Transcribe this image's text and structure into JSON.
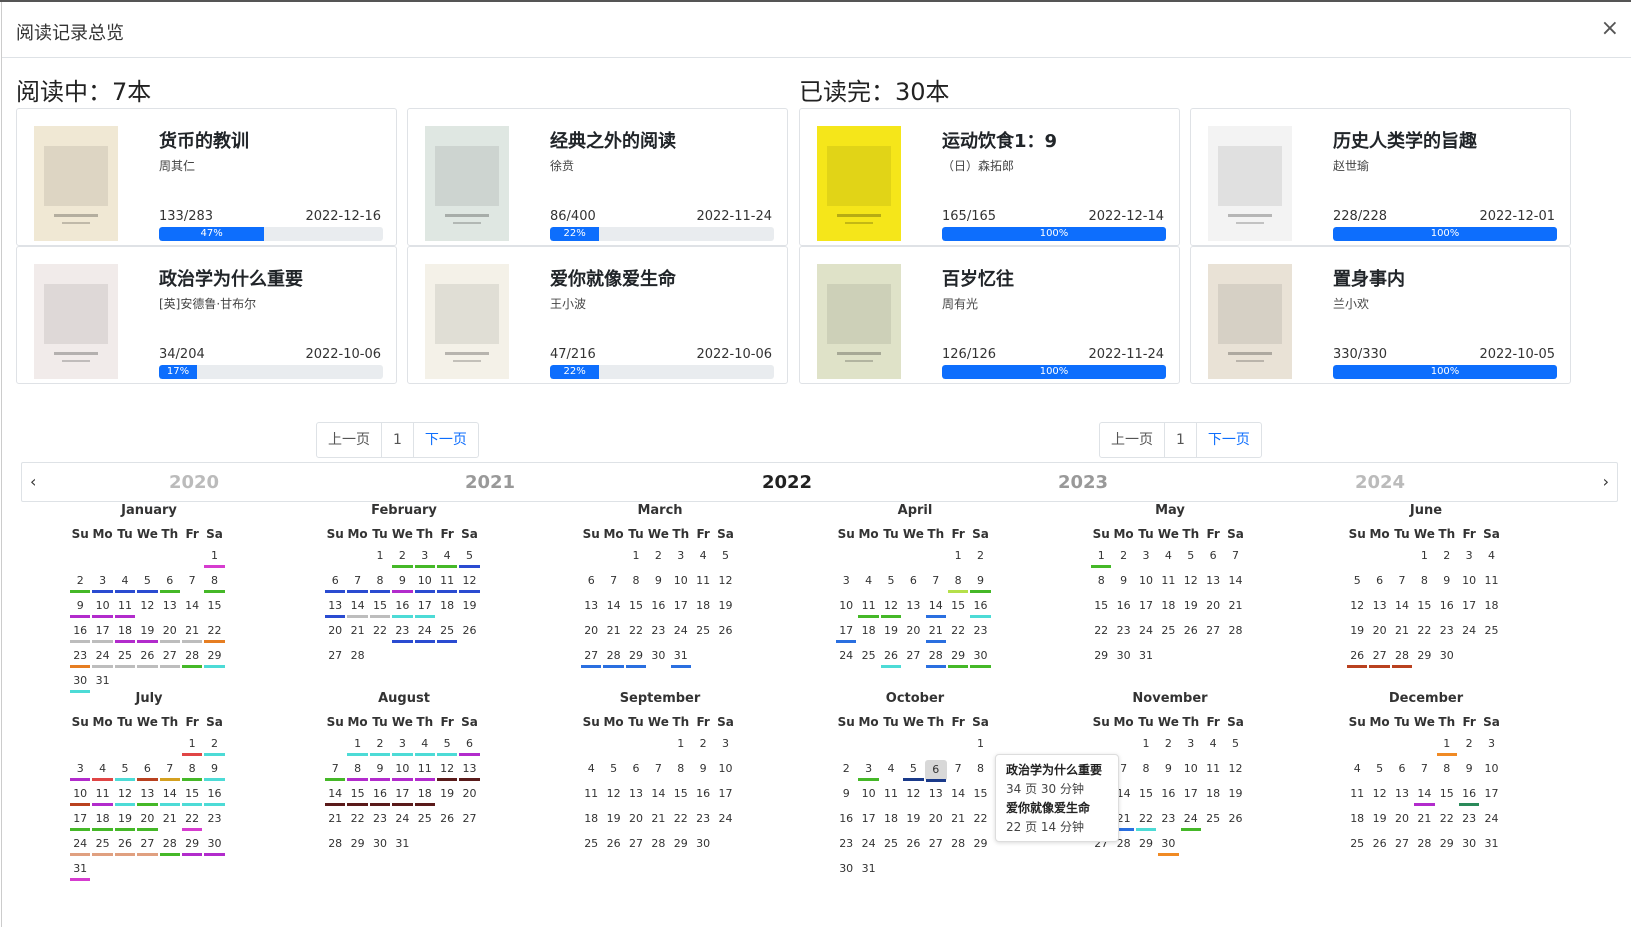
{
  "title": "阅读记录总览",
  "close_label": "×",
  "reading": {
    "heading": "阅读中：7本",
    "books": [
      {
        "title": "货币的教训",
        "author": "周其仁",
        "progress": "133/283",
        "date": "2022-12-16",
        "percent": "47%",
        "ratio": 0.47,
        "cover_color": "#f0e8d4"
      },
      {
        "title": "经典之外的阅读",
        "author": "徐贲",
        "progress": "86/400",
        "date": "2022-11-24",
        "percent": "22%",
        "ratio": 0.22,
        "cover_color": "#dfe7e2"
      },
      {
        "title": "政治学为什么重要",
        "author": "[英]安德鲁·甘布尔",
        "progress": "34/204",
        "date": "2022-10-06",
        "percent": "17%",
        "ratio": 0.17,
        "cover_color": "#f1ebea"
      },
      {
        "title": "爱你就像爱生命",
        "author": "王小波",
        "progress": "47/216",
        "date": "2022-10-06",
        "percent": "22%",
        "ratio": 0.22,
        "cover_color": "#f4f1e8"
      }
    ],
    "pager": {
      "prev": "上一页",
      "page": "1",
      "next": "下一页"
    }
  },
  "finished": {
    "heading": "已读完：30本",
    "books": [
      {
        "title": "运动饮食1：9",
        "author": "（日）森拓郎",
        "progress": "165/165",
        "date": "2022-12-14",
        "percent": "100%",
        "ratio": 1,
        "cover_color": "#f5e61a"
      },
      {
        "title": "历史人类学的旨趣",
        "author": "赵世瑜",
        "progress": "228/228",
        "date": "2022-12-01",
        "percent": "100%",
        "ratio": 1,
        "cover_color": "#f3f3f3"
      },
      {
        "title": "百岁忆往",
        "author": "周有光",
        "progress": "126/126",
        "date": "2022-11-24",
        "percent": "100%",
        "ratio": 1,
        "cover_color": "#dfe2c8"
      },
      {
        "title": "置身事内",
        "author": "兰小欢",
        "progress": "330/330",
        "date": "2022-10-05",
        "percent": "100%",
        "ratio": 1,
        "cover_color": "#e9e2d6"
      }
    ],
    "pager": {
      "prev": "上一页",
      "page": "1",
      "next": "下一页"
    }
  },
  "years": [
    "2020",
    "2021",
    "2022",
    "2023",
    "2024"
  ],
  "current_year": "2022",
  "weekdays": [
    "Su",
    "Mo",
    "Tu",
    "We",
    "Th",
    "Fr",
    "Sa"
  ],
  "months": [
    {
      "name": "January",
      "start": 6,
      "days": 31,
      "marks": {
        "1": [
          "#d63ccf"
        ],
        "2": [
          "#45b828"
        ],
        "3": [
          "#2a4bd1"
        ],
        "4": [
          "#2a4bd1"
        ],
        "5": [
          "#2a4bd1"
        ],
        "6": [
          "#45b828"
        ],
        "8": [
          "#45b828"
        ],
        "9": [
          "#b22bcc"
        ],
        "10": [
          "#b22bcc"
        ],
        "11": [
          "#b22bcc"
        ],
        "16": [
          "#bdbdbd"
        ],
        "17": [
          "#bdbdbd"
        ],
        "18": [
          "#b22bcc"
        ],
        "19": [
          "#b22bcc"
        ],
        "20": [
          "#bdbdbd"
        ],
        "21": [
          "#bdbdbd"
        ],
        "22": [
          "#e67e22"
        ],
        "23": [
          "#e67e22"
        ],
        "24": [
          "#bdbdbd"
        ],
        "25": [
          "#bdbdbd"
        ],
        "26": [
          "#bdbdbd"
        ],
        "27": [
          "#bdbdbd"
        ],
        "28": [
          "#45b828"
        ],
        "29": [
          "#4ddbd6"
        ],
        "30": [
          "#4ddbd6"
        ]
      }
    },
    {
      "name": "February",
      "start": 2,
      "days": 28,
      "marks": {
        "2": [
          "#45b828"
        ],
        "3": [
          "#45b828"
        ],
        "4": [
          "#45b828"
        ],
        "5": [
          "#2a4bd1"
        ],
        "6": [
          "#2a4bd1"
        ],
        "7": [
          "#2a4bd1"
        ],
        "8": [
          "#2a4bd1"
        ],
        "9": [
          "#b22bcc"
        ],
        "10": [
          "#2a4bd1"
        ],
        "11": [
          "#2a4bd1"
        ],
        "12": [
          "#2a4bd1"
        ],
        "13": [
          "#2a4bd1"
        ],
        "14": [
          "#bdbdbd"
        ],
        "15": [
          "#bdbdbd"
        ],
        "16": [
          "#4ddbd6"
        ],
        "17": [
          "#4ddbd6"
        ],
        "23": [
          "#2a4bd1"
        ],
        "24": [
          "#2a4bd1"
        ],
        "25": [
          "#2a4bd1"
        ]
      }
    },
    {
      "name": "March",
      "start": 2,
      "days": 31,
      "marks": {
        "27": [
          "#2a6fe0"
        ],
        "28": [
          "#2a6fe0"
        ],
        "29": [
          "#2a6fe0"
        ],
        "31": [
          "#2a6fe0"
        ]
      }
    },
    {
      "name": "April",
      "start": 5,
      "days": 30,
      "marks": {
        "8": [
          "#b5e04a"
        ],
        "9": [
          "#45b828"
        ],
        "11": [
          "#45b828"
        ],
        "12": [
          "#45b828"
        ],
        "14": [
          "#2a6fe0"
        ],
        "16": [
          "#4ddbd6"
        ],
        "17": [
          "#2a6fe0"
        ],
        "21": [
          "#2a6fe0"
        ],
        "26": [
          "#4ddbd6"
        ],
        "28": [
          "#2a6fe0"
        ],
        "29": [
          "#45b828"
        ],
        "30": [
          "#45b828"
        ]
      }
    },
    {
      "name": "May",
      "start": 0,
      "days": 31,
      "marks": {
        "1": [
          "#45b828"
        ]
      }
    },
    {
      "name": "June",
      "start": 3,
      "days": 30,
      "marks": {
        "26": [
          "#b9411f"
        ],
        "27": [
          "#b9411f"
        ],
        "28": [
          "#b9411f"
        ]
      }
    },
    {
      "name": "July",
      "start": 5,
      "days": 31,
      "marks": {
        "1": [
          "#e04545"
        ],
        "2": [
          "#4ddbd6"
        ],
        "3": [
          "#b22bcc"
        ],
        "4": [
          "#e04545"
        ],
        "5": [
          "#4ddbd6"
        ],
        "6": [
          "#b9411f"
        ],
        "7": [
          "#d4a020"
        ],
        "8": [
          "#45b828"
        ],
        "9": [
          "#4ddbd6"
        ],
        "10": [
          "#b9411f"
        ],
        "11": [
          "#b22bcc"
        ],
        "12": [
          "#4ddbd6"
        ],
        "13": [
          "#45b828"
        ],
        "14": [
          "#4ddbd6"
        ],
        "15": [
          "#4ddbd6"
        ],
        "16": [
          "#4ddbd6"
        ],
        "17": [
          "#45b828"
        ],
        "18": [
          "#45b828"
        ],
        "19": [
          "#45b828"
        ],
        "20": [
          "#45b828"
        ],
        "22": [
          "#d63ccf"
        ],
        "24": [
          "#e0a080"
        ],
        "25": [
          "#e0a080"
        ],
        "26": [
          "#e0a080"
        ],
        "27": [
          "#e0a080"
        ],
        "28": [
          "#45b828"
        ],
        "29": [
          "#b22bcc"
        ],
        "30": [
          "#b22bcc"
        ],
        "31": [
          "#d63ccf"
        ]
      }
    },
    {
      "name": "August",
      "start": 1,
      "days": 31,
      "marks": {
        "1": [
          "#4ddbd6"
        ],
        "2": [
          "#4ddbd6"
        ],
        "3": [
          "#4ddbd6"
        ],
        "4": [
          "#4ddbd6"
        ],
        "5": [
          "#4ddbd6"
        ],
        "6": [
          "#b22bcc"
        ],
        "7": [
          "#45b828"
        ],
        "8": [
          "#b22bcc"
        ],
        "9": [
          "#b22bcc"
        ],
        "10": [
          "#b22bcc"
        ],
        "11": [
          "#b22bcc"
        ],
        "12": [
          "#5a1a1a"
        ],
        "13": [
          "#5a1a1a"
        ],
        "14": [
          "#5a1a1a"
        ],
        "15": [
          "#5a1a1a"
        ],
        "16": [
          "#5a1a1a"
        ],
        "17": [
          "#5a1a1a"
        ],
        "18": [
          "#5a1a1a"
        ]
      }
    },
    {
      "name": "September",
      "start": 4,
      "days": 30,
      "marks": {}
    },
    {
      "name": "October",
      "start": 6,
      "days": 31,
      "highlight": 6,
      "marks": {
        "3": [
          "#45b828"
        ],
        "5": [
          "#1a3a8a"
        ],
        "6": [
          "#1a3a8a"
        ]
      }
    },
    {
      "name": "November",
      "start": 2,
      "days": 30,
      "marks": {
        "21": [
          "#2a6fe0"
        ],
        "20": [
          "#2a6fe0"
        ],
        "22": [
          "#4ddbd6"
        ],
        "24": [
          "#45b828"
        ],
        "30": [
          "#f08a24"
        ]
      }
    },
    {
      "name": "December",
      "start": 4,
      "days": 31,
      "marks": {
        "1": [
          "#f08a24"
        ],
        "14": [
          "#b22bcc"
        ],
        "16": [
          "#2a8a5a"
        ]
      }
    }
  ],
  "tooltip": {
    "book1": "政治学为什么重要",
    "detail1": "34 页 30 分钟",
    "book2": "爱你就像爱生命",
    "detail2": "22 页 14 分钟"
  },
  "colors": {
    "accent": "#0d6efd"
  }
}
